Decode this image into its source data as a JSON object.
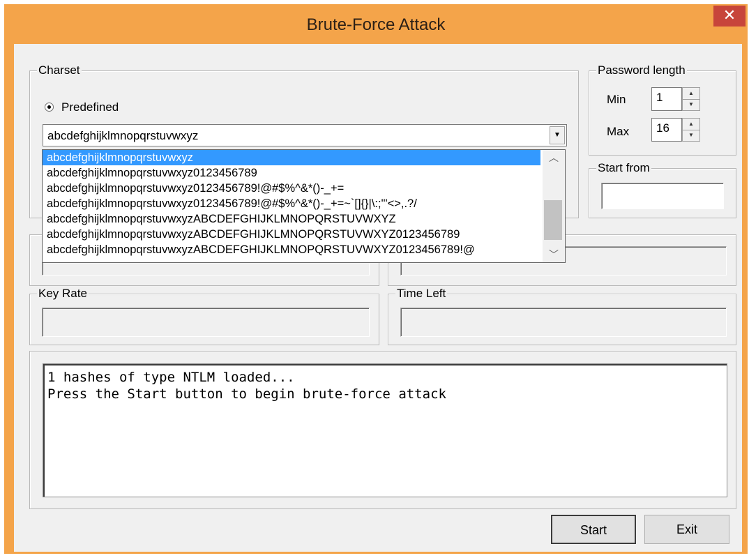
{
  "window": {
    "title": "Brute-Force Attack",
    "close_glyph": "✕"
  },
  "charset": {
    "group_label": "Charset",
    "predefined_label": "Predefined",
    "selected_value": "abcdefghijklmnopqrstuvwxyz",
    "options": [
      "abcdefghijklmnopqrstuvwxyz",
      "abcdefghijklmnopqrstuvwxyz0123456789",
      "abcdefghijklmnopqrstuvwxyz0123456789!@#$%^&*()-_+=",
      "abcdefghijklmnopqrstuvwxyz0123456789!@#$%^&*()-_+=~`[]{}|\\:;\"'<>,.?/",
      "abcdefghijklmnopqrstuvwxyzABCDEFGHIJKLMNOPQRSTUVWXYZ",
      "abcdefghijklmnopqrstuvwxyzABCDEFGHIJKLMNOPQRSTUVWXYZ0123456789",
      "abcdefghijklmnopqrstuvwxyzABCDEFGHIJKLMNOPQRSTUVWXYZ0123456789!@"
    ]
  },
  "password_length": {
    "group_label": "Password length",
    "min_label": "Min",
    "min_value": "1",
    "max_label": "Max",
    "max_value": "16"
  },
  "start_from": {
    "group_label": "Start from",
    "value": ""
  },
  "key_rate": {
    "group_label": "Key Rate",
    "value": ""
  },
  "time_left": {
    "group_label": "Time Left",
    "value": ""
  },
  "log": {
    "lines": [
      "1 hashes of type NTLM loaded...",
      "Press the Start button to begin brute-force attack"
    ]
  },
  "buttons": {
    "start": "Start",
    "exit": "Exit"
  }
}
